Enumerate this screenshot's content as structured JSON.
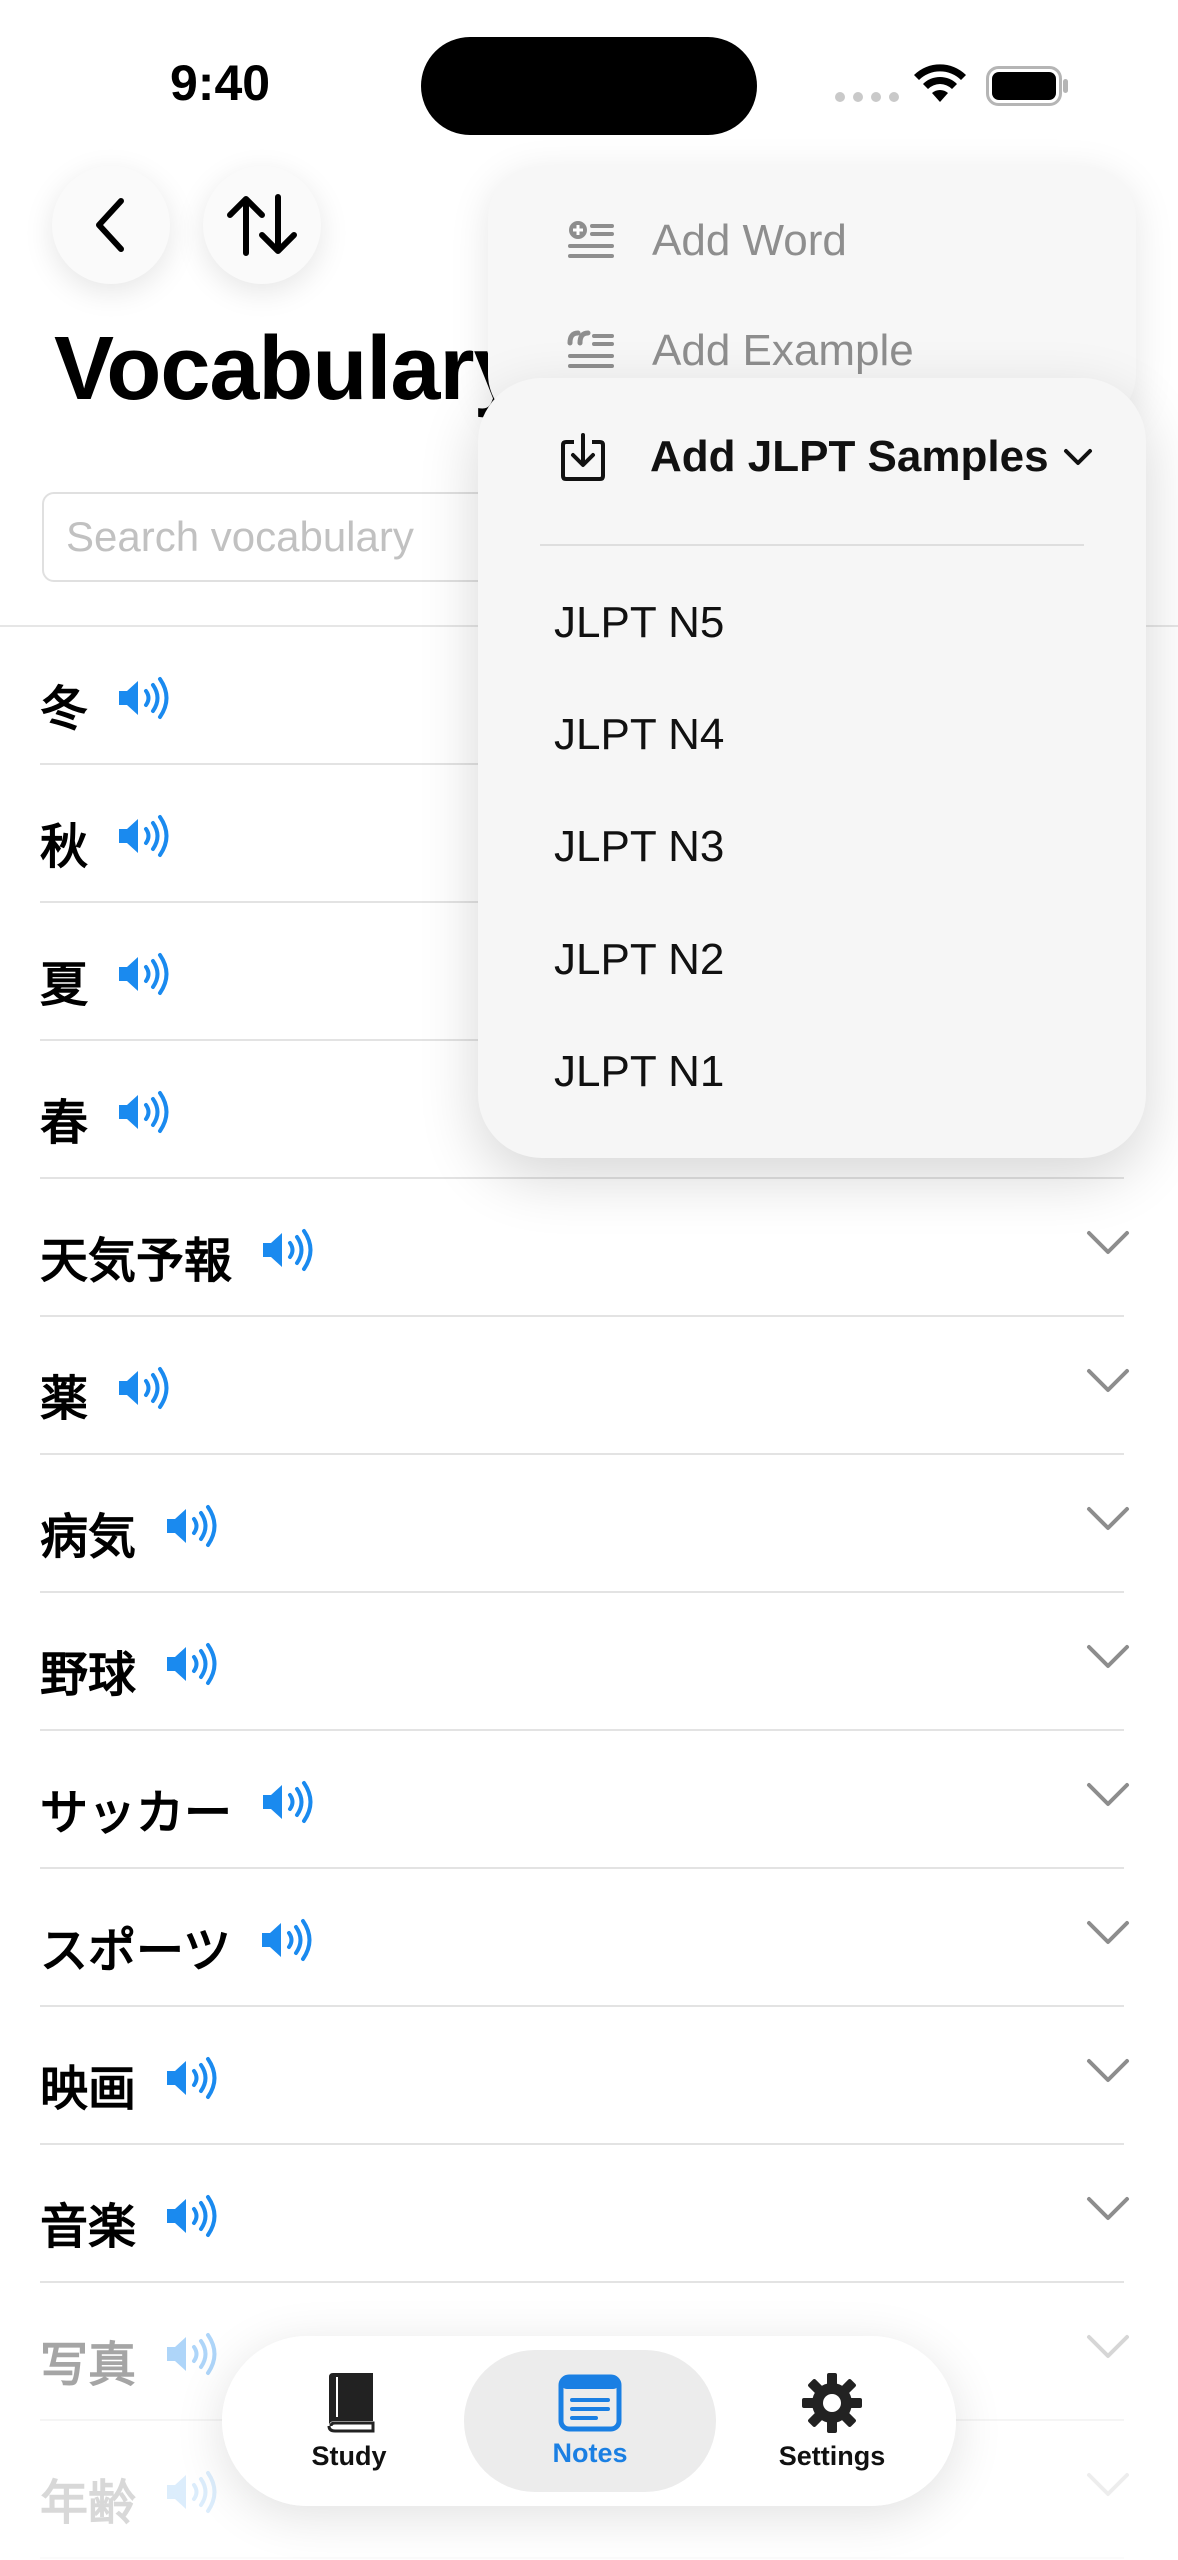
{
  "status_bar": {
    "time": "9:40"
  },
  "header": {
    "title": "Vocabulary",
    "back_icon": "chevron-left-icon",
    "sort_icon": "arrow-up-down-icon"
  },
  "search": {
    "placeholder": "Search vocabulary",
    "value": ""
  },
  "vocabulary": [
    {
      "word": "冬"
    },
    {
      "word": "秋"
    },
    {
      "word": "夏"
    },
    {
      "word": "春"
    },
    {
      "word": "天気予報"
    },
    {
      "word": "薬"
    },
    {
      "word": "病気"
    },
    {
      "word": "野球"
    },
    {
      "word": "サッカー"
    },
    {
      "word": "スポーツ"
    },
    {
      "word": "映画"
    },
    {
      "word": "音楽"
    },
    {
      "word": "写真"
    },
    {
      "word": "年齢"
    }
  ],
  "add_menu": {
    "items": [
      {
        "label": "Add Word",
        "icon": "add-word-icon"
      },
      {
        "label": "Add Example",
        "icon": "add-example-icon"
      }
    ]
  },
  "jlpt_submenu": {
    "title": "Add JLPT Samples",
    "icon": "download-tray-icon",
    "options": [
      "JLPT N5",
      "JLPT N4",
      "JLPT N3",
      "JLPT N2",
      "JLPT N1"
    ]
  },
  "tab_bar": {
    "tabs": [
      {
        "label": "Study",
        "icon": "book-icon"
      },
      {
        "label": "Notes",
        "icon": "notes-icon"
      },
      {
        "label": "Settings",
        "icon": "gear-icon"
      }
    ],
    "active": "Notes"
  },
  "colors": {
    "accent": "#1a7fe3",
    "speaker": "#1a8aef"
  }
}
